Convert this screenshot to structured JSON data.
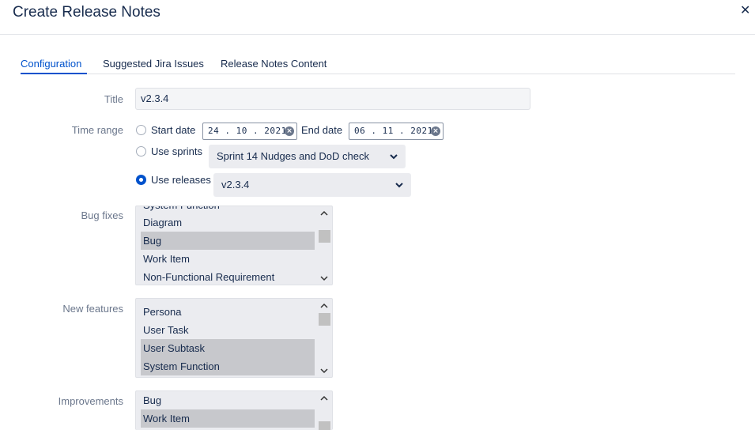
{
  "dialog": {
    "title": "Create Release Notes",
    "close_glyph": "✕"
  },
  "tabs": [
    {
      "label": "Configuration",
      "active": true
    },
    {
      "label": "Suggested Jira Issues",
      "active": false
    },
    {
      "label": "Release Notes Content",
      "active": false
    }
  ],
  "form": {
    "title_label": "Title",
    "title_value": "v2.3.4",
    "time_range_label": "Time range",
    "start_date_label": "Start date",
    "start_date_value": "24 . 10 . 2021",
    "end_date_label": "End date",
    "end_date_value": "06 . 11 . 2021",
    "use_sprints_label": "Use sprints",
    "sprint_selected": "Sprint 14 Nudges and DoD check",
    "use_releases_label": "Use releases",
    "release_selected": "v2.3.4",
    "selected_mode": "use-releases",
    "bug_fixes_label": "Bug fixes",
    "bug_fixes_partial_top": "System Function",
    "bug_fixes_options": [
      {
        "label": "Diagram",
        "selected": false
      },
      {
        "label": "Bug",
        "selected": true
      },
      {
        "label": "Work Item",
        "selected": false
      },
      {
        "label": "Non-Functional Requirement",
        "selected": false
      }
    ],
    "new_features_label": "New features",
    "new_features_options": [
      {
        "label": "Persona",
        "selected": false
      },
      {
        "label": "User Task",
        "selected": false
      },
      {
        "label": "User Subtask",
        "selected": true
      },
      {
        "label": "System Function",
        "selected": true
      }
    ],
    "improvements_label": "Improvements",
    "improvements_options": [
      {
        "label": "Bug",
        "selected": false
      },
      {
        "label": "Work Item",
        "selected": true
      }
    ]
  },
  "colors": {
    "accent": "#0052cc",
    "selected_option_bg": "#c7c8cc",
    "listbox_bg": "#ebecf0"
  }
}
